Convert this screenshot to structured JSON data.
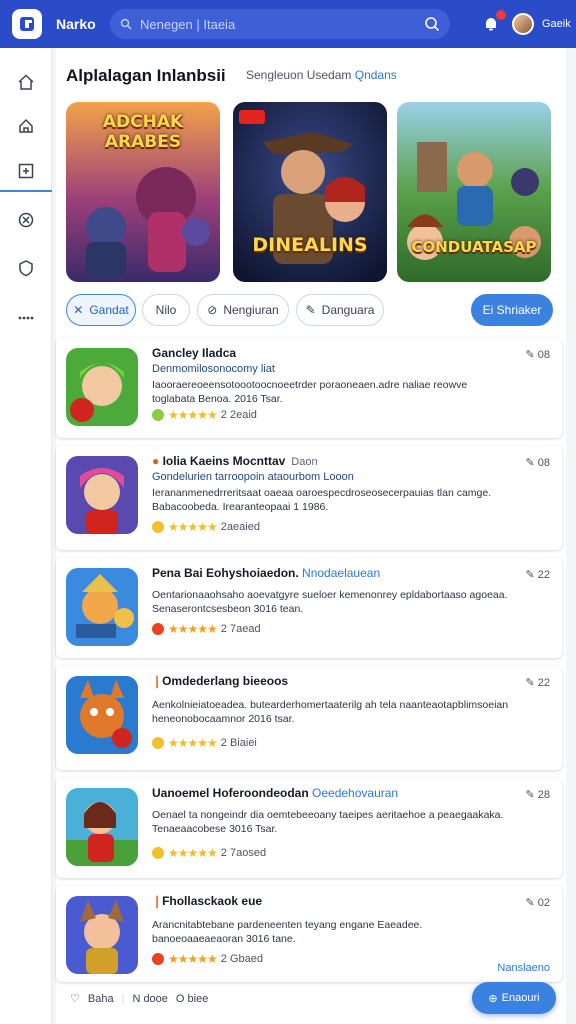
{
  "app": {
    "brand": "Narko",
    "user": "Gaeik"
  },
  "search": {
    "placeholder": "Nenegen | Itaeia"
  },
  "colors": {
    "topbar": "#2b4cc9",
    "accent": "#3b82e0",
    "link": "#2e78d6"
  },
  "sidebar": {
    "items": [
      {
        "icon": "home-icon"
      },
      {
        "icon": "store-icon"
      },
      {
        "icon": "add-square-icon"
      },
      {
        "icon": "gamepad-icon"
      },
      {
        "icon": "shield-icon"
      },
      {
        "icon": "more-dots-icon"
      }
    ]
  },
  "header": {
    "title": "Alplalagan  Inlanbsii",
    "subtitle": "Sengleuon Usedam",
    "subtitle_link": "Qndans"
  },
  "banners": [
    {
      "title": "ADCHAK ARABES"
    },
    {
      "title": "DINEALINS"
    },
    {
      "title": "CONDUATASAP"
    }
  ],
  "filters": {
    "chips": [
      "Gandat",
      "Nilo",
      "Nengiuran",
      "Danguara"
    ],
    "primary": "Ei Shriaker"
  },
  "apps": [
    {
      "name": "Gancley Iladca",
      "sub": "Denmomilosonocomy liat",
      "desc": "Iaooraereoeensotoootoocnoeetrder poraoneaen.adre naliae reowve toglabata Benoa. 2016 Tsar.",
      "rating": "2 2eaid",
      "edit": "08"
    },
    {
      "name": "Iolia Kaeins Mocnttav",
      "extra": "Daon",
      "sub": "Gondelurien tarroopoin ataourbom Looon",
      "desc": "Ierananmenedrreritsaat oaeaa oaroespecdroseosecerpauias tlan camge. Babacoobeda. Irearanteopaai 1 1986.",
      "rating": "2aeaied",
      "edit": "08"
    },
    {
      "name": "Pena Bai Eohyshoiaedon.",
      "hl": "Nnodaelauean",
      "desc": "Oentarionaaohsaho aoevatgyre sueloer kemenonrey epldabortaaso agoeaa. Senaserontcsesbeon 3016 tean.",
      "rating": "2 7aead",
      "edit": "22"
    },
    {
      "name": "Omdederlang bieeoos",
      "desc": "Aenkolnieiatoeadea. butearderhomertaaterilg ah tela naanteaotapblimsoeian heneonobocaamnor 2016 tsar.",
      "rating": "2 Biaiei",
      "edit": "22"
    },
    {
      "name": "Uanoemel Hoferoondeodan",
      "hl": "Oeedehovauran",
      "desc": "Oenael ta nongeindr dia oemtebeeoany taeipes aeritaehoe a peaegaakaka. Tenaeaacobese 3016 Tsar.",
      "rating": "2 7aosed",
      "edit": "28"
    },
    {
      "name": "Fhollasckaok eue",
      "desc": "Arancnitabtebane pardeneenten teyang engane Eaeadee. banoeoaaeaeaoran 3016 tane.",
      "rating": "2 Gbaed",
      "edit": "02",
      "more": "Nanslaeno"
    }
  ],
  "footer": {
    "like_count": "Baha",
    "b2": "N dooe",
    "b3": "O biee"
  },
  "fab": {
    "label": "Enaouri"
  }
}
